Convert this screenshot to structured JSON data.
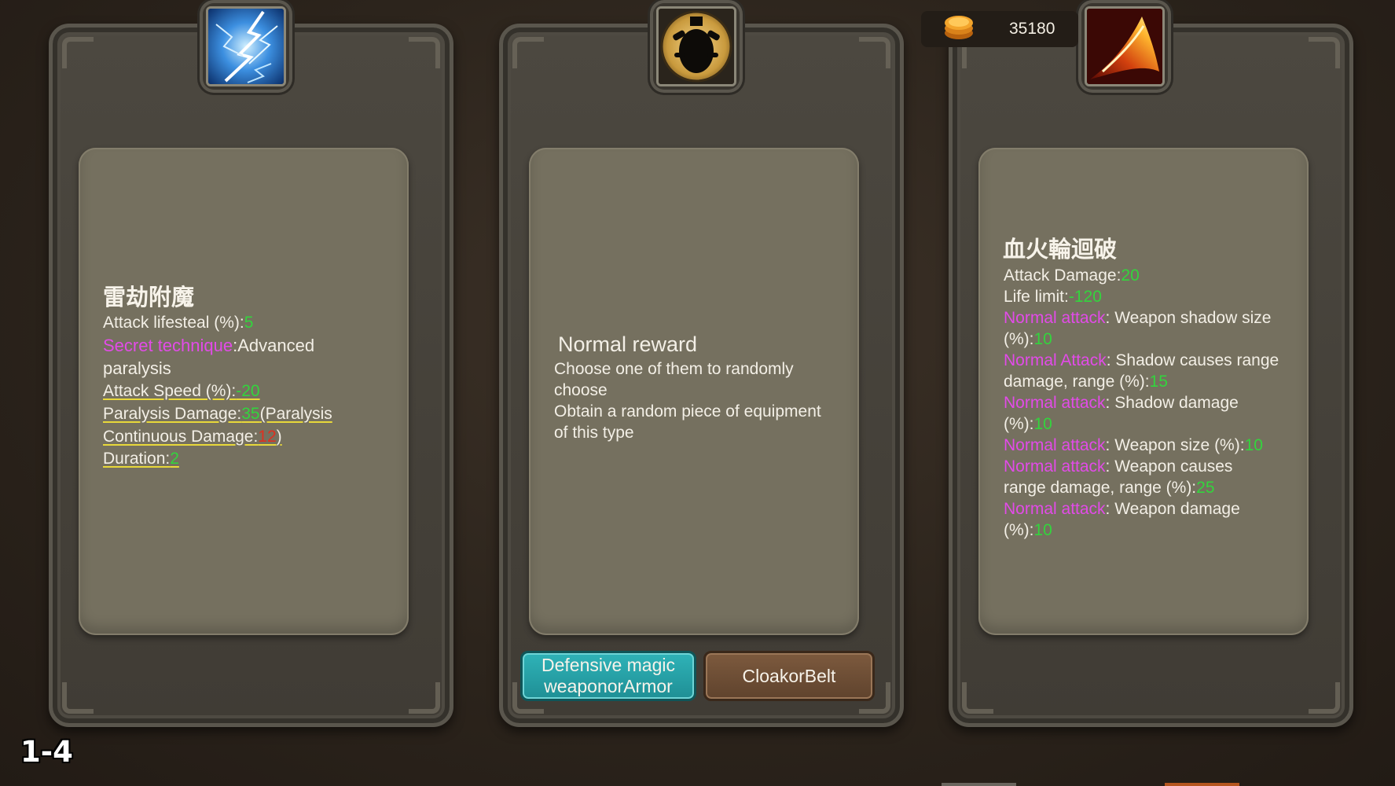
{
  "currency": {
    "icon": "gold-coin-icon",
    "amount": "35180"
  },
  "stage_label": "1-4",
  "cards": {
    "left": {
      "icon": "lightning-icon",
      "title": "雷劫附魔",
      "lines": {
        "l1_label": "Attack lifesteal (%):",
        "l1_value": "5",
        "l2_label": "Secret technique",
        "l2_text": ":Advanced",
        "l3_text": "paralysis",
        "l4_label": "Attack Speed (%):",
        "l4_value": "-20",
        "l5_label": "Paralysis Damage:",
        "l5_value": "35",
        "l5_text": "(Paralysis",
        "l6_label": "Continuous Damage:",
        "l6_value": "12",
        "l6_text": ")",
        "l7_label": "Duration:",
        "l7_value": "2"
      }
    },
    "middle": {
      "icon": "armor-silhouette-icon",
      "title": "Normal reward",
      "desc1": "Choose one of them to randomly",
      "desc2": "choose",
      "desc3": "Obtain a random piece of equipment",
      "desc4": "of this type",
      "buttons": {
        "defensive_line1": "Defensive magic",
        "defensive_line2": "weaponorArmor",
        "cloak": "CloakorBelt"
      }
    },
    "right": {
      "icon": "fire-slash-icon",
      "title": "血火輪迴破",
      "lines": {
        "r1_label": "Attack Damage:",
        "r1_value": "20",
        "r2_label": "Life limit:",
        "r2_value": "-120",
        "r3_label": "Normal attack",
        "r3_text": ": Weapon shadow size",
        "r4_text": "(%):",
        "r4_value": "10",
        "r5_label": "Normal Attack",
        "r5_text": ": Shadow causes range",
        "r6_text": "damage, range (%):",
        "r6_value": "15",
        "r7_label": "Normal attack",
        "r7_text": ": Shadow damage",
        "r8_text": "(%):",
        "r8_value": "10",
        "r9_label": "Normal attack",
        "r9_text": ": Weapon size (%):",
        "r9_value": "10",
        "r10_label": "Normal attack",
        "r10_text": ": Weapon causes",
        "r11_text": "range damage, range (%):",
        "r11_value": "25",
        "r12_label": "Normal attack",
        "r12_text": ": Weapon damage",
        "r13_text": "(%):",
        "r13_value": "10"
      }
    }
  },
  "colors": {
    "stat_value": "#33d43d",
    "keyword": "#e24be8",
    "negative_value": "#e0301f",
    "button_teal": "#2fb3b8",
    "button_brown": "#7d5a3e"
  }
}
